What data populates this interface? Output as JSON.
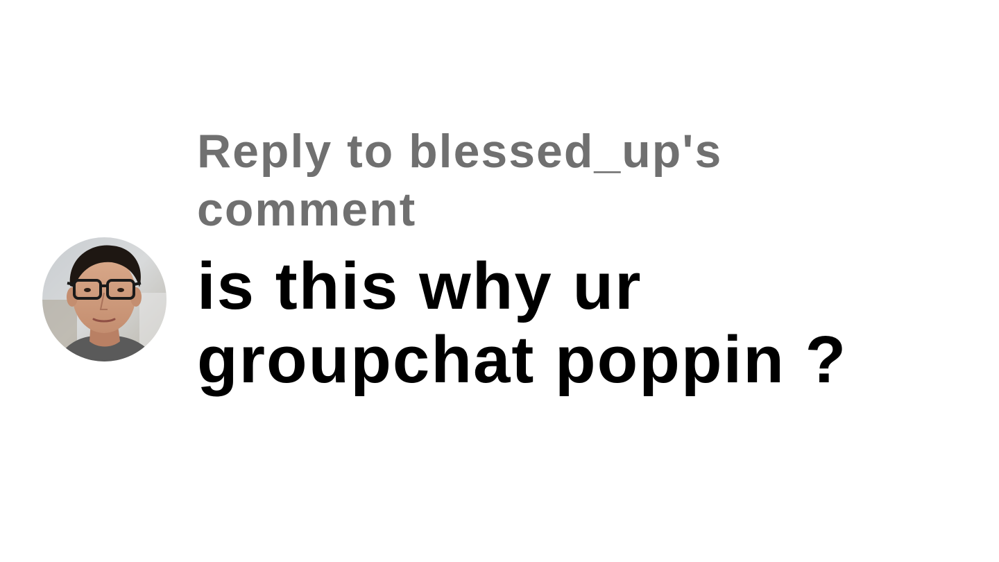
{
  "reply": {
    "label": "Reply to blessed_up's comment"
  },
  "comment": {
    "text": "is this why ur groupchat poppin ?"
  },
  "avatar": {
    "icon": "user-avatar-photo"
  },
  "colors": {
    "background": "#ffffff",
    "reply_label": "#707070",
    "comment_text": "#000000"
  }
}
